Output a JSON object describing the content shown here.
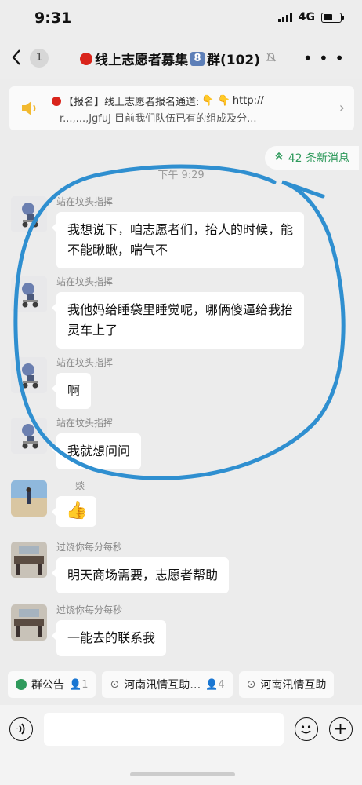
{
  "status_bar": {
    "time": "9:31",
    "network": "4G",
    "battery_level": 0.55
  },
  "nav": {
    "back_icon": "chevron-left-icon",
    "unread_count": "1",
    "title": "线上志愿者募集",
    "title_badge": "8",
    "title_suffix": "群(102)",
    "more_icon": "ellipsis-icon"
  },
  "notice": {
    "line1_prefix": "【报名】线上志愿者报名通道:",
    "line1_url": "http://",
    "line2": "r...,...,JgfuJ  目前我们队伍已有的组成及分..."
  },
  "new_messages": "42 条新消息",
  "time_label": "下午 9:29",
  "messages": [
    {
      "sender": "站在坟头指挥",
      "text": "我想说下，咱志愿者们，抬人的时候，能不能瞅瞅，喘气不"
    },
    {
      "sender": "站在坟头指挥",
      "text": "我他妈给睡袋里睡觉呢，哪俩傻逼给我抬灵车上了"
    },
    {
      "sender": "站在坟头指挥",
      "text": "啊"
    },
    {
      "sender": "站在坟头指挥",
      "text": "我就想问问"
    },
    {
      "sender": "____燚",
      "text": "👍"
    },
    {
      "sender": "过饶你每分每秒",
      "text": "明天商场需要，志愿者帮助"
    },
    {
      "sender": "过饶你每分每秒",
      "text": "一能去的联系我"
    }
  ],
  "chips": [
    {
      "label": "群公告",
      "count": "1"
    },
    {
      "label": "河南汛情互助…",
      "count": "4"
    },
    {
      "label": "河南汛情互助",
      "count": ""
    }
  ],
  "colors": {
    "accent_green": "#2f9a5c",
    "bubble": "#ffffff",
    "annotation_circle": "#2f8fd0"
  }
}
